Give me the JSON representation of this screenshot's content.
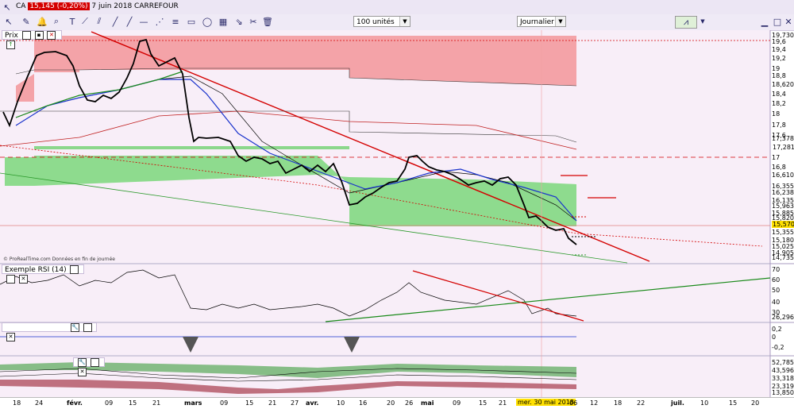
{
  "toolbar": {
    "symbol_icon": "pointer-icon",
    "ticker": "CA",
    "price_change": "15,145 (-0,20%)",
    "date_name": "7 juin 2018 CARREFOUR"
  },
  "controls": {
    "quantity_value": "100 unités",
    "period_value": "Journalier"
  },
  "panels": {
    "price": {
      "label": "Prix"
    },
    "rsi": {
      "label": "Exemple RSI (14)"
    }
  },
  "watermark": "© ProRealTime.com  Données en fin de journée",
  "price_axis": [
    "19,730",
    "19,6",
    "19,4",
    "19,2",
    "19",
    "18,8",
    "18,620",
    "18,4",
    "18,2",
    "18",
    "17,8",
    "17,6",
    "17,378",
    "17,281",
    "17",
    "16,8",
    "16,610",
    "16,355",
    "16,238",
    "16,135",
    "15,963",
    "15,885",
    "15,820",
    "15,570",
    "15,355",
    "15,180",
    "15,025",
    "14,905",
    "14,735"
  ],
  "rsi_axis": [
    "70",
    "60",
    "50",
    "40",
    "30",
    "26,296"
  ],
  "osc_axis": [
    "0,2",
    "0",
    "-0,2"
  ],
  "vol_axis": [
    "52,785",
    "43,596",
    "33,318",
    "23,319",
    "13,850"
  ],
  "x_axis": [
    "18",
    "24",
    "févr.",
    "09",
    "15",
    "21",
    "mars",
    "09",
    "15",
    "21",
    "27",
    "avr.",
    "10",
    "16",
    "20",
    "26",
    "mai",
    "09",
    "15",
    "21",
    "mer. 30 mai 2018",
    "06",
    "12",
    "18",
    "22",
    "juil.",
    "10",
    "15",
    "20"
  ],
  "colors": {
    "red_zone": "#f4a3a8",
    "green_zone": "#7ed47e",
    "price_line": "#000000",
    "trend_red": "#d40000",
    "ma_blue": "#1a33cc",
    "ma_green": "#1a8a1a"
  }
}
